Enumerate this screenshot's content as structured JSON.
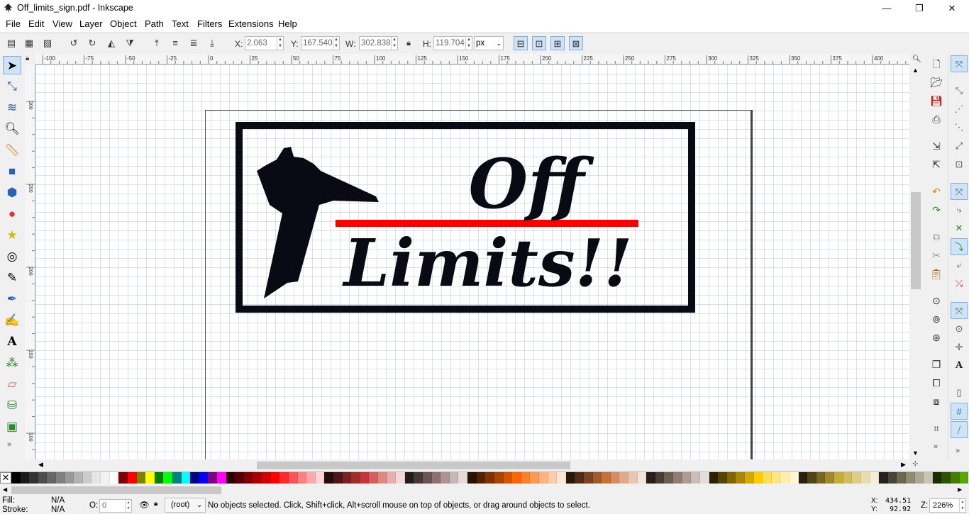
{
  "window": {
    "title": "Off_limits_sign.pdf - Inkscape",
    "minimize": "—",
    "maximize": "❐",
    "close": "✕"
  },
  "menu": [
    "File",
    "Edit",
    "View",
    "Layer",
    "Object",
    "Path",
    "Text",
    "Filters",
    "Extensions",
    "Help"
  ],
  "toolbar": {
    "x_label": "X:",
    "x_value": "2.063",
    "y_label": "Y:",
    "y_value": "167.540",
    "w_label": "W:",
    "w_value": "302.838",
    "h_label": "H:",
    "h_value": "119.704",
    "unit": "px"
  },
  "tools": [
    "selector",
    "node",
    "tweak",
    "zoom",
    "measure",
    "rectangle",
    "3d-box",
    "circle",
    "star",
    "spiral",
    "pencil",
    "pen",
    "calligraphy",
    "text",
    "spray",
    "eraser",
    "paint-bucket",
    "gradient"
  ],
  "hruler_ticks": [
    "-100",
    "-75",
    "-50",
    "-25",
    "0",
    "25",
    "50",
    "75",
    "100",
    "125",
    "150",
    "175",
    "200",
    "225",
    "250",
    "275",
    "300",
    "325",
    "350",
    "375",
    "400",
    "425"
  ],
  "vruler_ticks": [
    "300",
    "250",
    "200",
    "150",
    "100"
  ],
  "artwork": {
    "line1": "Off",
    "line2": "Limits!!",
    "frame_color": "#0a0a14",
    "bar_color": "#ff0000"
  },
  "palette": [
    "#000000",
    "#1a1a1a",
    "#333333",
    "#4d4d4d",
    "#666666",
    "#808080",
    "#999999",
    "#b3b3b3",
    "#cccccc",
    "#e6e6e6",
    "#f2f2f2",
    "#ffffff",
    "#800000",
    "#ff0000",
    "#808000",
    "#ffff00",
    "#008000",
    "#00ff00",
    "#008080",
    "#00ffff",
    "#000080",
    "#0000ff",
    "#800080",
    "#ff00ff",
    "#2b0000",
    "#550000",
    "#800000",
    "#aa0000",
    "#d40000",
    "#ff0000",
    "#ff2a2a",
    "#ff5555",
    "#ff8080",
    "#ffaaaa",
    "#ffd5d5",
    "#280b0b",
    "#501616",
    "#782121",
    "#a02c2c",
    "#c83737",
    "#d35f5f",
    "#de8787",
    "#e9afaf",
    "#f4d7d7",
    "#241c1c",
    "#483737",
    "#6c5353",
    "#916f6f",
    "#ac9393",
    "#c8b7b7",
    "#e3dbdb",
    "#2b1100",
    "#552200",
    "#803300",
    "#aa4400",
    "#d45500",
    "#ff6600",
    "#ff7f2a",
    "#ff9955",
    "#ffb380",
    "#ffccaa",
    "#ffe6d5",
    "#28170b",
    "#502d16",
    "#784421",
    "#a05a2c",
    "#c87137",
    "#d38d5f",
    "#deaa87",
    "#e9c6af",
    "#f4e3d7",
    "#241f1c",
    "#483e37",
    "#6c5d53",
    "#917c6f",
    "#ac9d93",
    "#c8beb7",
    "#e3dedb",
    "#2b2200",
    "#554400",
    "#806600",
    "#aa8800",
    "#d4aa00",
    "#ffcc00",
    "#ffdd55",
    "#ffe680",
    "#ffeeaa",
    "#fff6d5",
    "#28220b",
    "#504416",
    "#786721",
    "#a0892c",
    "#c8ab37",
    "#d3bc5f",
    "#decd87",
    "#e9ddaf",
    "#f4eed7",
    "#24221c",
    "#484537",
    "#6c6753",
    "#918a6f",
    "#aca793",
    "#c8c4b7",
    "#1c2b00",
    "#2b5500",
    "#448000",
    "#55aa00"
  ],
  "status": {
    "fill_label": "Fill:",
    "fill_value": "N/A",
    "stroke_label": "Stroke:",
    "stroke_value": "N/A",
    "opacity_label": "O:",
    "opacity_value": "0",
    "layer": "(root)",
    "message": "No objects selected. Click, Shift+click, Alt+scroll mouse on top of objects, or drag around objects to select.",
    "x_label": "X:",
    "x_value": "434.51",
    "y_label": "Y:",
    "y_value": "92.92",
    "zoom_label": "Z:",
    "zoom_value": "226%"
  }
}
